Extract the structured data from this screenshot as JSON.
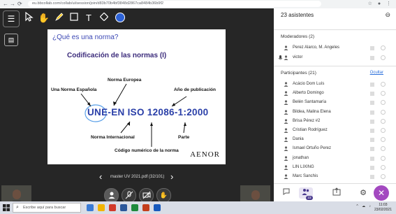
{
  "browser": {
    "url": "eu.bbcollab.com/collab/ui/session/join/d83b70b4bf3848d2867ca8484b36b9f2"
  },
  "toolbar": {
    "menu_icon": "menu-icon",
    "tools": [
      "pointer-tool-icon",
      "hand-tool-icon",
      "pen-tool-icon",
      "shape-tool-icon",
      "text-tool-icon",
      "eraser-tool-icon",
      "color-picker-icon"
    ],
    "accent": "#2d62d6"
  },
  "slide": {
    "question": "¿Qué es una norma?",
    "title": "Codificación de las normas (I)",
    "label_norma_europea": "Norma Europea",
    "label_una_norma_espanola": "Una Norma Española",
    "label_ano_publicacion": "Año de publicación",
    "code": "UNE-EN ISO 12086-1:2000",
    "label_norma_internacional": "Norma Internacional",
    "label_parte": "Parte",
    "label_codigo_numerico": "Código numérico de la norma",
    "brand": "AENOR"
  },
  "pager": {
    "filename": "master UV 2021.pdf",
    "page": "(32/101)"
  },
  "controls": {
    "items": [
      "avatar",
      "mute-mic-icon",
      "camera-off-icon",
      "raise-hand-icon"
    ]
  },
  "panel": {
    "header": "23 asistentes",
    "moderators_label": "Moderadores (2)",
    "moderators": [
      "Perez Alarco, M. Angeles",
      "victor"
    ],
    "participants_label": "Participantes (21)",
    "hide_label": "Ocultar",
    "participants": [
      "Acácio Dom Luís",
      "Alberto Domingo",
      "Belén Santamaría",
      "Bildea, Malina Elena",
      "Brisa Pérez #2",
      "Cristian Rodríguez",
      "Dania",
      "Ismael Ortuño Perez",
      "jonathan",
      "LIN LIXING",
      "Marc Sanchis"
    ],
    "badge": "23"
  },
  "taskbar": {
    "search_placeholder": "Escribe aquí para buscar",
    "time": "11:03",
    "date": "23/02/2021",
    "app_colors": [
      "#3a7bd5",
      "#f2b400",
      "#d23a2a",
      "#2b579a",
      "#1e8a3c",
      "#c43e1c",
      "#185abd"
    ]
  }
}
